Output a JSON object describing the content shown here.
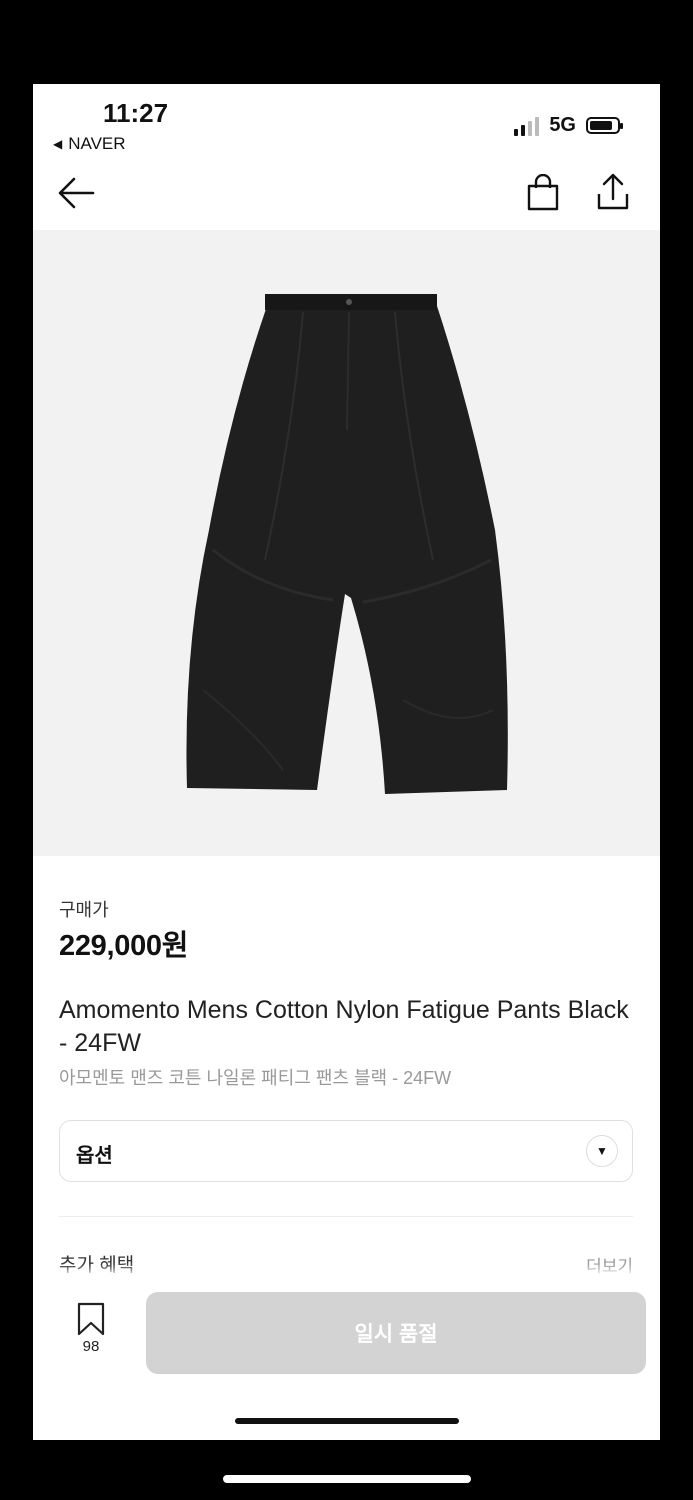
{
  "status_bar": {
    "time": "11:27",
    "back_app": "NAVER",
    "network": "5G",
    "signal_bars_active": 2,
    "signal_bars_total": 4
  },
  "nav": {
    "back_icon": "arrow-left-icon",
    "cart_icon": "shopping-bag-icon",
    "share_icon": "share-icon"
  },
  "product": {
    "image_icon": "black-fatigue-pants-photo",
    "image_bg_color": "#f2f2f2",
    "price_label": "구매가",
    "price": "229,000원",
    "title_en": "Amomento Mens Cotton Nylon Fatigue Pants Black - 24FW",
    "title_ko": "아모멘토 맨즈 코튼 나일론 패티그 팬츠 블랙 - 24FW"
  },
  "options": {
    "label": "옵션",
    "chevron_icon": "chevron-down-icon"
  },
  "benefits": {
    "label": "추가 혜택",
    "more": "더보기"
  },
  "bottom_bar": {
    "wishlist_icon": "bookmark-icon",
    "wishlist_count": "98",
    "buy_button": "일시 품절",
    "buy_button_color": "#d3d3d3"
  }
}
